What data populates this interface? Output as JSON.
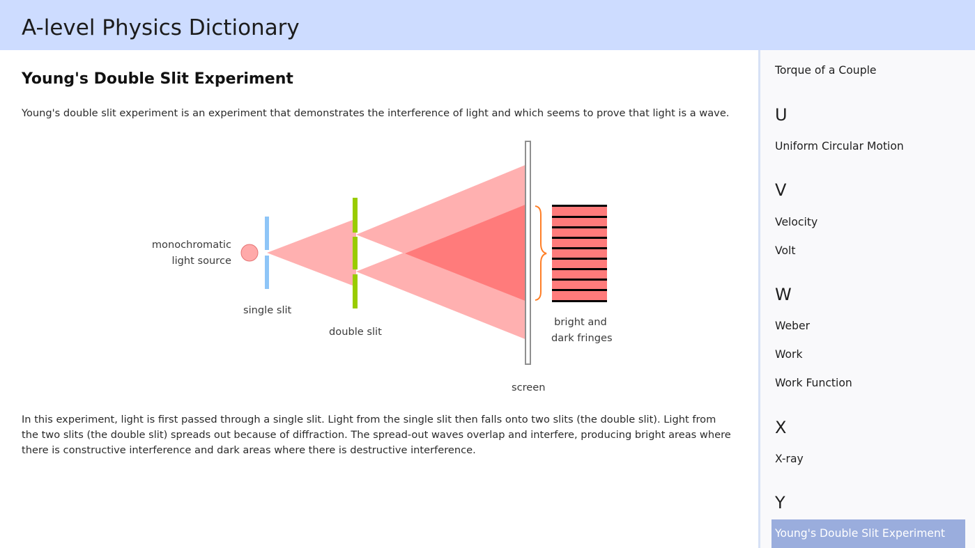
{
  "app": {
    "title": "A-level Physics Dictionary"
  },
  "article": {
    "title": "Young's Double Slit Experiment",
    "intro": "Young's double slit experiment is an experiment that demonstrates the interference of light and which seems to prove that light is a wave.",
    "body": "In this experiment, light is first passed through a single slit. Light from the single slit then falls onto two slits (the double slit). Light from the two slits (the double slit) spreads out because of diffraction. The spread-out waves overlap and interfere, producing bright areas where there is constructive interference and dark areas where there is destructive interference."
  },
  "diagram": {
    "labels": {
      "source_line1": "monochromatic",
      "source_line2": "light source",
      "single_slit": "single slit",
      "double_slit": "double slit",
      "fringes_line1": "bright and",
      "fringes_line2": "dark fringes",
      "screen": "screen"
    },
    "colors": {
      "light": "#ff9a9a",
      "overlap": "#ff6f6f",
      "single_slit": "#8ec5f7",
      "double_slit": "#99cc00",
      "brace": "#ff7f27",
      "fringe_bright": "#ff7b7b",
      "fringe_dark": "#000000"
    },
    "fringe_count": 9
  },
  "sidebar": {
    "items": [
      {
        "type": "item",
        "label": "Torque of a Couple"
      },
      {
        "type": "letter",
        "label": "U"
      },
      {
        "type": "item",
        "label": "Uniform Circular Motion"
      },
      {
        "type": "letter",
        "label": "V"
      },
      {
        "type": "item",
        "label": "Velocity"
      },
      {
        "type": "item",
        "label": "Volt"
      },
      {
        "type": "letter",
        "label": "W"
      },
      {
        "type": "item",
        "label": "Weber"
      },
      {
        "type": "item",
        "label": "Work"
      },
      {
        "type": "item",
        "label": "Work Function"
      },
      {
        "type": "letter",
        "label": "X"
      },
      {
        "type": "item",
        "label": "X-ray"
      },
      {
        "type": "letter",
        "label": "Y"
      },
      {
        "type": "item",
        "label": "Young's Double Slit Experiment",
        "selected": true
      }
    ]
  }
}
